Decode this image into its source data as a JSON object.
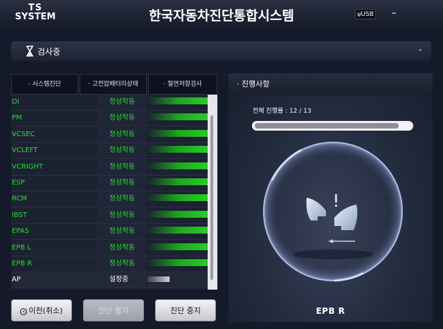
{
  "titlebar": {
    "logo_line1": "TS",
    "logo_line2": "SYSTEM",
    "title": "한국자동차진단통합시스템",
    "usb_label": "USB",
    "minimize_label": "–"
  },
  "status": {
    "text": "검사중",
    "collapse_label": "-"
  },
  "tabs": [
    "· 시스템진단",
    "· 고전압배터리상태",
    "· 절연저항검사"
  ],
  "table_rows": [
    {
      "name": "DI",
      "status": "정상작동",
      "progress_fraction": 1.0,
      "state": "ok"
    },
    {
      "name": "PM",
      "status": "정상작동",
      "progress_fraction": 1.0,
      "state": "ok"
    },
    {
      "name": "VCSEC",
      "status": "정상작동",
      "progress_fraction": 1.0,
      "state": "ok"
    },
    {
      "name": "VCLEFT",
      "status": "정상작동",
      "progress_fraction": 1.0,
      "state": "ok"
    },
    {
      "name": "VCRIGHT",
      "status": "정상작동",
      "progress_fraction": 1.0,
      "state": "ok"
    },
    {
      "name": "ESP",
      "status": "정상작동",
      "progress_fraction": 1.0,
      "state": "ok"
    },
    {
      "name": "RCM",
      "status": "정상작동",
      "progress_fraction": 1.0,
      "state": "ok"
    },
    {
      "name": "IBST",
      "status": "정상작동",
      "progress_fraction": 1.0,
      "state": "ok"
    },
    {
      "name": "EPAS",
      "status": "정상작동",
      "progress_fraction": 1.0,
      "state": "ok"
    },
    {
      "name": "EPB L",
      "status": "정상작동",
      "progress_fraction": 1.0,
      "state": "ok"
    },
    {
      "name": "EPB R",
      "status": "정상작동",
      "progress_fraction": 1.0,
      "state": "ok"
    },
    {
      "name": "AP",
      "status": "설정중",
      "progress_fraction": 0.3,
      "state": "pending"
    }
  ],
  "buttons": {
    "prev_icon": "<",
    "prev_label": "이전(취소)",
    "retry_label": "진단 불가",
    "stop_label": "진단 중지"
  },
  "progress_panel": {
    "header": "· 진행사항",
    "progress_text": "전체 진행률 : 12 / 13",
    "done": 12,
    "total": 13,
    "current_item": "EPB R"
  },
  "colors": {
    "ok_text": "#2fd93a",
    "bar_green": "#2bd82b",
    "background": "#141a2a"
  },
  "icons": {
    "hourglass": "hourglass-icon",
    "usb": "usb-icon",
    "caliper": "brake-caliper-icon",
    "warning": "warning-icon"
  }
}
